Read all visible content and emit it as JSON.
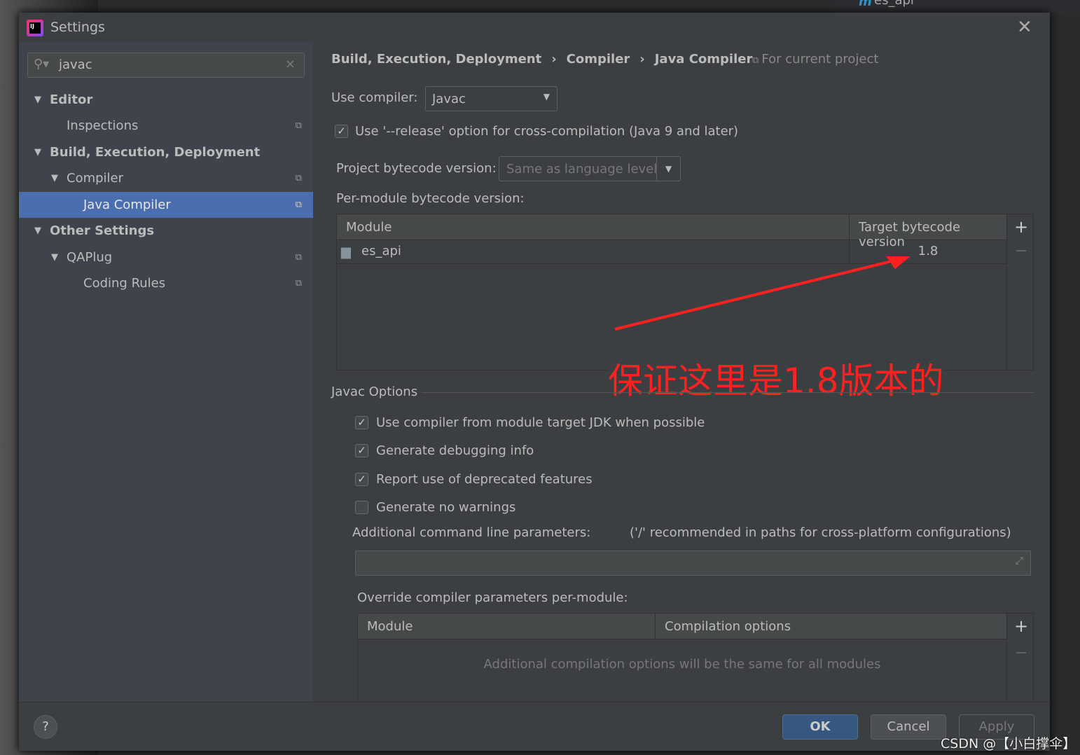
{
  "background": {
    "project_item": "es_api"
  },
  "window": {
    "title": "Settings"
  },
  "search": {
    "value": "javac"
  },
  "sidebar": {
    "items": [
      {
        "label": "Editor",
        "level": 0,
        "expanded": true,
        "bold": true
      },
      {
        "label": "Inspections",
        "level": 1
      },
      {
        "label": "Build, Execution, Deployment",
        "level": 0,
        "expanded": true,
        "bold": true
      },
      {
        "label": "Compiler",
        "level": 1,
        "expanded": true
      },
      {
        "label": "Java Compiler",
        "level": 2,
        "selected": true
      },
      {
        "label": "Other Settings",
        "level": 0,
        "expanded": true,
        "bold": true
      },
      {
        "label": "QAPlug",
        "level": 1,
        "expanded": true
      },
      {
        "label": "Coding Rules",
        "level": 2
      }
    ]
  },
  "breadcrumb": {
    "items": [
      "Build, Execution, Deployment",
      "Compiler",
      "Java Compiler"
    ],
    "scope": "For current project"
  },
  "main": {
    "use_compiler_label": "Use compiler:",
    "use_compiler_value": "Javac",
    "release_option_label": "Use '--release' option for cross-compilation (Java 9 and later)",
    "release_option_checked": true,
    "project_bytecode_label": "Project bytecode version:",
    "project_bytecode_value": "Same as language level",
    "per_module_label": "Per-module bytecode version:",
    "module_table": {
      "headers": [
        "Module",
        "Target bytecode version"
      ],
      "rows": [
        {
          "module": "es_api",
          "version": "1.8"
        }
      ]
    },
    "annotation": "保证这里是1.8版本的",
    "javac_options_title": "Javac Options",
    "options": [
      {
        "label": "Use compiler from module target JDK when possible",
        "checked": true
      },
      {
        "label": "Generate debugging info",
        "checked": true
      },
      {
        "label": "Report use of deprecated features",
        "checked": true
      },
      {
        "label": "Generate no warnings",
        "checked": false
      }
    ],
    "additional_label": "Additional command line parameters:",
    "additional_hint": "('/' recommended in paths for cross-platform configurations)",
    "additional_value": "",
    "override_label": "Override compiler parameters per-module:",
    "override_table": {
      "headers": [
        "Module",
        "Compilation options"
      ],
      "empty_text": "Additional compilation options will be the same for all modules"
    }
  },
  "footer": {
    "ok": "OK",
    "cancel": "Cancel",
    "apply": "Apply",
    "help": "?"
  },
  "watermark": "CSDN @【小白撑伞】",
  "colors": {
    "accent": "#4b6eaf",
    "ok_button": "#365880",
    "annotation": "#ff2020"
  }
}
